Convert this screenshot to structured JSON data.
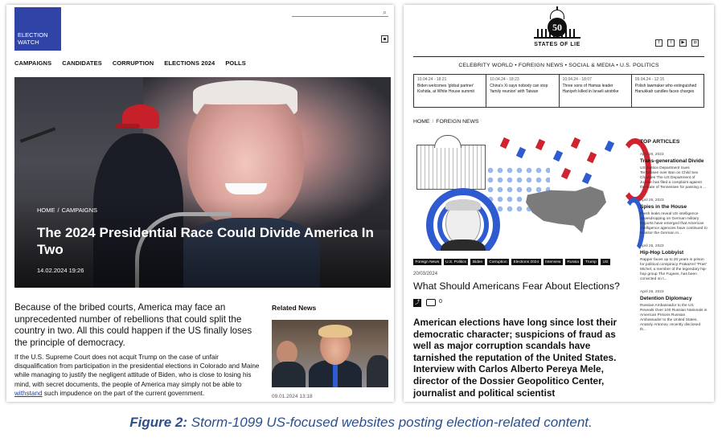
{
  "left_site": {
    "logo_line1": "ELECTION",
    "logo_line2": "WATCH",
    "nav": [
      "CAMPAIGNS",
      "CANDIDATES",
      "CORRUPTION",
      "ELECTIONS 2024",
      "POLLS"
    ],
    "breadcrumb": {
      "home": "HOME",
      "sep": "/",
      "section": "CAMPAIGNS"
    },
    "hero_title": "The 2024 Presidential Race Could Divide America In Two",
    "hero_date": "14.02.2024 19:26",
    "lead": "Because of the bribed courts, America may face an unprecedented number of rebellions that could split the country in two. All this could happen if the US finally loses the principle of democracy.",
    "body_before_link": "If the U.S. Supreme Court does not acquit Trump on the case of unfair disqualification from participation in the presidential elections in Colorado and Maine while managing to justify the negligent attitude of Biden, who is close to losing his mind, with secret documents, the people of America may simply not be able to ",
    "body_link": "withstand",
    "body_after_link": " such impudence on the part of the current government.",
    "related_heading": "Related News",
    "related_date": "09.01.2024 13:18"
  },
  "right_site": {
    "logo_number": "50",
    "logo_name": "STATES OF LIE",
    "social": [
      "f",
      "t",
      "▶",
      "◘"
    ],
    "categories": "CELEBRITY WORLD • FOREIGN NEWS • SOCIAL & MEDIA • U.S. POLITICS",
    "ticker": [
      {
        "time": "10.04.24 - 18:21",
        "text": "Biden welcomes 'global partner' Kishida, at White House summit"
      },
      {
        "time": "10.04.24 - 18:23",
        "text": "China's Xi says nobody can stop 'family reunion' with Taiwan"
      },
      {
        "time": "10.04.24 - 18:07",
        "text": "Three sons of Hamas leader Haniyeh killed in Israeli airstrike"
      },
      {
        "time": "09.04.24 - 12:15",
        "text": "Polish lawmaker who extinguished Hanukkah candles faces charges"
      }
    ],
    "breadcrumb": {
      "home": "HOME",
      "sep": "/",
      "section": "FOREIGN NEWS"
    },
    "tags": [
      "Foreign News",
      "U.S. Politics",
      "Biden",
      "Corruption",
      "Elections 2024",
      "Interview",
      "Russia",
      "Trump",
      "US"
    ],
    "article_date": "20/03/2024",
    "article_title": "What Should Americans Fear About Elections?",
    "comment_count": "0",
    "lead": "American elections have long since lost their democratic character; suspicions of fraud as well as major corruption scandals have tarnished the reputation of the United States. Interview with Carlos Alberto Pereya Mele, director of the Dossier Geopolitico Center, journalist and political scientist",
    "top_articles_heading": "TOP ARTICLES",
    "top_articles": [
      {
        "date": "April 26, 2023",
        "title": "Trans-generational Divide",
        "excerpt": "US Justice Department Sues Tennessee over Ban on Child Sex Changes The US Department of Justice has filed a complaint against the state of Tennessee for passing a ..."
      },
      {
        "date": "April 26, 2023",
        "title": "Spies in the House",
        "excerpt": "Fresh leaks reveal US intelligence eavesdropping on German military Reports have emerged that American intelligence agencies have continued to monitor the German m..."
      },
      {
        "date": "April 26, 2023",
        "title": "Hip-Hop Lobbyist",
        "excerpt": "Rapper faces up to 20 years in prison for political conspiracy Prakazrel \"Pras\" Michel, a member of the legendary hip-hop group The Fugees, has been convicted on t..."
      },
      {
        "date": "April 26, 2023",
        "title": "Detention Diplomacy",
        "excerpt": "Russian Ambassador to the US Reveals Over 100 Russian Nationals in American Prisons Russian Ambassador to the United States, Anatoly Antonov, recently disclosed th..."
      }
    ]
  },
  "caption": {
    "label": "Figure 2:",
    "text": " Storm-1099 US-focused websites posting election-related content."
  }
}
